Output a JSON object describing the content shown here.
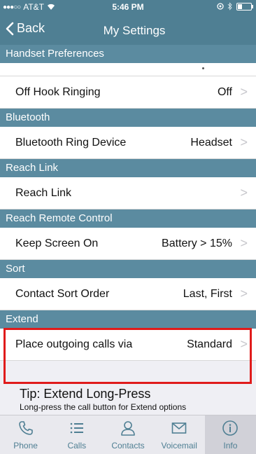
{
  "status_bar": {
    "carrier": "AT&T",
    "time": "5:46 PM"
  },
  "nav": {
    "back_label": "Back",
    "title": "My Settings"
  },
  "sections": {
    "handset": {
      "header": "Handset Preferences",
      "off_hook_label": "Off Hook Ringing",
      "off_hook_value": "Off"
    },
    "bluetooth": {
      "header": "Bluetooth",
      "label": "Bluetooth Ring Device",
      "value": "Headset"
    },
    "reach_link": {
      "header": "Reach Link",
      "label": "Reach Link",
      "value": ""
    },
    "reach_remote": {
      "header": "Reach Remote Control",
      "label": "Keep Screen On",
      "value": "Battery > 15%"
    },
    "sort": {
      "header": "Sort",
      "label": "Contact Sort Order",
      "value": "Last, First"
    },
    "extend": {
      "header": "Extend",
      "label": "Place outgoing calls via",
      "value": "Standard"
    }
  },
  "tip": {
    "title": "Tip: Extend Long-Press",
    "text": "Long-press the call button for Extend options"
  },
  "tabs": [
    {
      "label": "Phone",
      "icon": "phone-icon"
    },
    {
      "label": "Calls",
      "icon": "list-icon"
    },
    {
      "label": "Contacts",
      "icon": "person-icon"
    },
    {
      "label": "Voicemail",
      "icon": "envelope-icon"
    },
    {
      "label": "Info",
      "icon": "info-icon",
      "active": true
    }
  ],
  "colors": {
    "accent": "#4f7f93",
    "section": "#5b8ba0",
    "highlight": "#e01b1b"
  }
}
